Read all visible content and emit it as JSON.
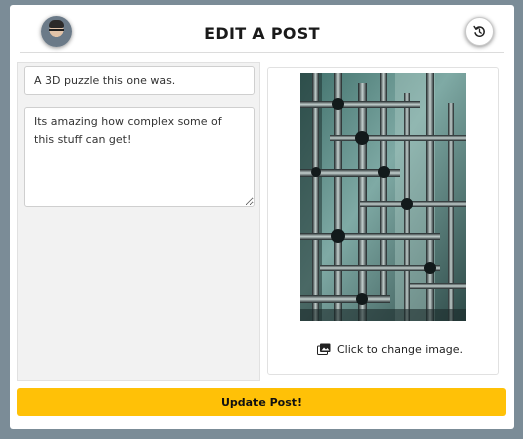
{
  "header": {
    "title": "EDIT A POST",
    "avatar_icon": "user-avatar",
    "reset_icon": "reset-icon"
  },
  "form": {
    "title_value": "A 3D puzzle this one was.",
    "body_value": "Its amazing how complex some of this stuff can get!"
  },
  "image_panel": {
    "change_label": "Click to change image.",
    "change_icon": "image-gallery-icon"
  },
  "actions": {
    "submit_label": "Update Post!"
  },
  "colors": {
    "page_background": "#7b8c97",
    "accent": "#ffc107"
  }
}
